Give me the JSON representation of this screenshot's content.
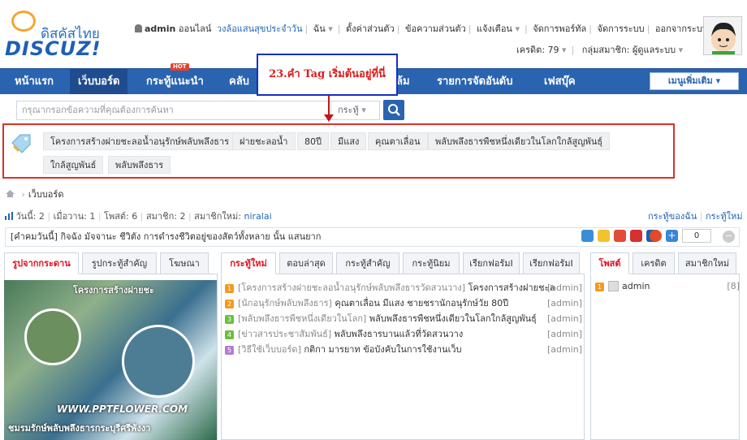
{
  "logo": {
    "thai": "ดิสคัสไทย",
    "brand": "DISCUZ!"
  },
  "topbar": {
    "user": "admin",
    "online": "ออนไลน์",
    "circle": "วงล้อแสนสุขประจำวัน",
    "links": [
      "ฉัน",
      "ตั้งค่าส่วนตัว",
      "ข้อความส่วนตัว",
      "แจ้งเตือน",
      "จัดการพอร์ทัล",
      "จัดการระบบ",
      "ออกจากระบบ"
    ],
    "credit": "เครดิต: 79",
    "group": "กลุ่มสมาชิก: ผู้ดูแลระบบ"
  },
  "nav": {
    "items": [
      "หน้าแรก",
      "เว็บบอร์ด",
      "กระทู้แนะนำ",
      "คลับ",
      "ล้ม",
      "รายการจัดอันดับ",
      "เฟสบุ๊ค"
    ],
    "hot_badge": "HOT",
    "more": "เมนูเพิ่มเติม"
  },
  "search": {
    "placeholder": "กรุณากรอกข้อความที่คุณต้องการค้นหา",
    "type": "กระทู้"
  },
  "callout": "23.คำ Tag เริ่มต้นอยู่ที่นี่",
  "tags": [
    "โครงการสร้างฝายชะลอน้ำอนุรักษ์พลับพลึงธาร",
    "ฝายชะลอน้ำ",
    "80ปี",
    "มีแสง",
    "คุณตาเลื่อน",
    "พลับพลึงธารพืชหนึ่งเดียวในโลกใกล้สูญพันธุ์",
    "ใกล้สูญพันธ์",
    "พลับพลึงธาร"
  ],
  "breadcrumb": "เว็บบอร์ด",
  "stats": {
    "today_label": "วันนี้:",
    "today": "2",
    "yesterday_label": "เมื่อวาน:",
    "yesterday": "1",
    "posts_label": "โพสต์:",
    "posts": "6",
    "members_label": "สมาชิก:",
    "members": "2",
    "newest_label": "สมาชิกใหม่:",
    "newest": "niralai"
  },
  "right_links": [
    "กระทู้ของฉัน",
    "กระทู้ใหม่"
  ],
  "notice": "[คำคมวันนี้] กิจฉัง มัจจานะ ชีวิตัง การดำรงชีวิตอยู่ของสัตว์ทั้งหลาย นั้น แสนยาก",
  "share_count": "0",
  "left_tabs": [
    "รูปจากกระดาน",
    "รูปกระทู้สำคัญ",
    "โฆษณา"
  ],
  "photo": {
    "caption": "โครงการสร้างฝายชะ",
    "url": "WWW.PPTFLOWER.COM",
    "footer": "ชมรมรักษ์พลับพลึงธารกระบุรีศรีพังงา"
  },
  "mid_tabs": [
    "กระทู้ใหม่",
    "ตอบล่าสุด",
    "กระทู้สำคัญ",
    "กระทู้นิยม",
    "เรียกฟอรัมI",
    "เรียกฟอรัมI"
  ],
  "threads": [
    {
      "n": "1",
      "color": "#f39a1e",
      "forum": "[โครงการสร้างฝายชะลอน้ำอนุรักษ์พลับพลึงธารวัดสวนวาง]",
      "title": "โครงการสร้างฝายชะล",
      "author": "[admin]"
    },
    {
      "n": "2",
      "color": "#f39a1e",
      "forum": "[นักอนุรักษ์พลับพลึงธาร]",
      "title": "คุณตาเลื่อน มีแสง ชายชรานักอนุรักษ์วัย 80ปี",
      "author": "[admin]"
    },
    {
      "n": "3",
      "color": "#f39a1e",
      "forum": "[พลับพลึงธารพืชหนึ่งเดียวในโลก]",
      "title": "พลับพลึงธารพืชหนึ่งเดียวในโลกใกล้สูญพันธุ์",
      "author": "[admin]"
    },
    {
      "n": "4",
      "color": "#6cbf3a",
      "forum": "[ข่าวสารประชาสัมพันธ์]",
      "title": "พลับพลึงธารบานแล้วที่วัดสวนวาง",
      "author": "[admin]"
    },
    {
      "n": "5",
      "color": "#b37cd1",
      "forum": "[วิธีใช้เว็บบอร์ด]",
      "title": "กติกา มารยาท ข้อบังคับในการใช้งานเว็บ",
      "author": "[admin]"
    }
  ],
  "right_tabs": [
    "โพสต์",
    "เครดิต",
    "สมาชิกใหม่"
  ],
  "ranking": [
    {
      "n": "1",
      "name": "admin",
      "count": "[8]"
    }
  ],
  "colors": {
    "nav": "#2a64b0",
    "accent_red": "#d9312b",
    "link": "#2365b8"
  }
}
